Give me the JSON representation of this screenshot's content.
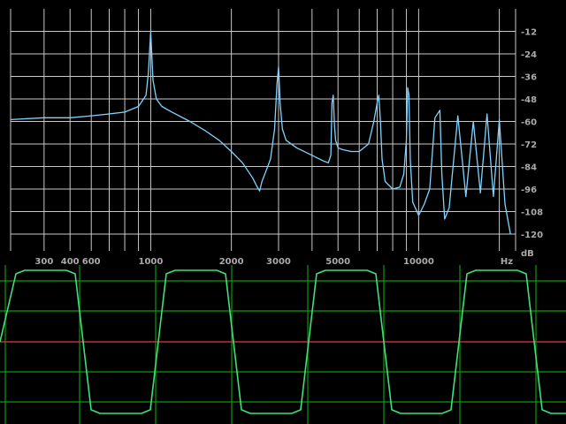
{
  "chart_data": [
    {
      "type": "line",
      "scale_x": "log",
      "x_ticks": [
        400,
        500,
        600,
        1000,
        2000,
        3000,
        5000,
        10000
      ],
      "x_tick_labels": [
        "300",
        "400",
        "600",
        "1000",
        "2000",
        "3000",
        "5000",
        "10000"
      ],
      "x_unit": "Hz",
      "y_unit": "dB",
      "y_ticks": [
        -12,
        -24,
        -36,
        -48,
        -60,
        -72,
        -84,
        -96,
        -108,
        -120
      ],
      "y_tick_labels": [
        "-12",
        "-24",
        "-36",
        "-48",
        "-60",
        "-72",
        "-84",
        "-96",
        "-108",
        "-120"
      ],
      "ylim": [
        0,
        -120
      ],
      "grid": true,
      "series": [
        {
          "color": "#7fd4ff",
          "x": [
            300,
            400,
            500,
            600,
            700,
            800,
            900,
            960,
            980,
            1000,
            1020,
            1050,
            1100,
            1200,
            1400,
            1600,
            1800,
            2000,
            2200,
            2400,
            2500,
            2550,
            2600,
            2700,
            2800,
            2900,
            2960,
            3000,
            3040,
            3100,
            3200,
            3500,
            4000,
            4400,
            4600,
            4700,
            4750,
            4800,
            4850,
            4900,
            5000,
            5200,
            5600,
            6000,
            6500,
            6800,
            7000,
            7100,
            7200,
            7300,
            7500,
            8000,
            8500,
            8800,
            9000,
            9100,
            9200,
            9300,
            9500,
            10000,
            10500,
            11000,
            11500,
            12000,
            12200,
            12500,
            13000,
            14000,
            15000,
            16000,
            17000,
            18000,
            19000,
            20000,
            21000,
            22000
          ],
          "y": [
            -59,
            -58,
            -58,
            -57,
            -56,
            -55,
            -52,
            -46,
            -34,
            -12,
            -38,
            -48,
            -52,
            -55,
            -60,
            -65,
            -70,
            -76,
            -82,
            -90,
            -95,
            -97,
            -92,
            -86,
            -80,
            -64,
            -40,
            -31,
            -50,
            -64,
            -70,
            -74,
            -78,
            -81,
            -82,
            -78,
            -50,
            -46,
            -62,
            -70,
            -74,
            -75,
            -76,
            -76,
            -72,
            -60,
            -50,
            -46,
            -60,
            -80,
            -92,
            -96,
            -95,
            -88,
            -70,
            -42,
            -46,
            -80,
            -103,
            -110,
            -104,
            -96,
            -58,
            -54,
            -88,
            -112,
            -106,
            -57,
            -100,
            -60,
            -98,
            -56,
            -100,
            -59,
            -104,
            -120
          ]
        }
      ]
    },
    {
      "type": "line",
      "grid": true,
      "series": [
        {
          "color": "#3fe07a",
          "x": [
            0,
            18,
            28,
            75,
            85,
            103,
            113,
            160,
            170,
            188,
            198,
            245,
            255,
            273,
            283,
            330,
            340,
            358,
            368,
            415,
            425,
            443,
            453,
            500,
            510,
            528,
            538,
            585,
            595,
            613,
            623,
            640
          ],
          "y": [
            0,
            0.95,
            1,
            1,
            0.95,
            -0.95,
            -1,
            -1,
            -0.95,
            0.95,
            1,
            1,
            0.95,
            -0.95,
            -1,
            -1,
            -0.95,
            0.95,
            1,
            1,
            0.95,
            -0.95,
            -1,
            -1,
            -0.95,
            0.95,
            1,
            1,
            0.95,
            -0.95,
            -1,
            -1
          ]
        }
      ]
    }
  ]
}
